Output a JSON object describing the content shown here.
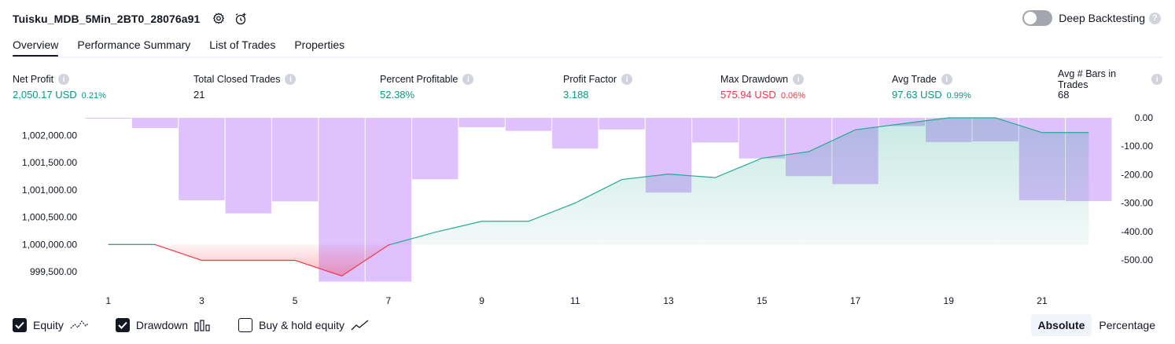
{
  "header": {
    "title": "Tuisku_MDB_5Min_2BT0_28076a91",
    "deep_backtesting_label": "Deep Backtesting",
    "help_glyph": "?"
  },
  "tabs": [
    {
      "label": "Overview",
      "active": true
    },
    {
      "label": "Performance Summary",
      "active": false
    },
    {
      "label": "List of Trades",
      "active": false
    },
    {
      "label": "Properties",
      "active": false
    }
  ],
  "metrics": [
    {
      "label": "Net Profit",
      "value": "2,050.17 USD",
      "pct": "0.21%",
      "color": "green"
    },
    {
      "label": "Total Closed Trades",
      "value": "21",
      "pct": "",
      "color": "dark"
    },
    {
      "label": "Percent Profitable",
      "value": "52.38%",
      "pct": "",
      "color": "green"
    },
    {
      "label": "Profit Factor",
      "value": "3.188",
      "pct": "",
      "color": "green"
    },
    {
      "label": "Max Drawdown",
      "value": "575.94 USD",
      "pct": "0.06%",
      "color": "red"
    },
    {
      "label": "Avg Trade",
      "value": "97.63 USD",
      "pct": "0.99%",
      "color": "green"
    },
    {
      "label": "Avg # Bars in Trades",
      "value": "68",
      "pct": "",
      "color": "dark"
    }
  ],
  "legend": {
    "equity_label": "Equity",
    "drawdown_label": "Drawdown",
    "buyhold_label": "Buy & hold equity",
    "equity_checked": true,
    "drawdown_checked": true,
    "buyhold_checked": false
  },
  "mode": {
    "absolute_label": "Absolute",
    "percentage_label": "Percentage",
    "selected": "Absolute"
  },
  "colors": {
    "equity_line": "#22ab94",
    "equity_fill": "#089981",
    "loss_line": "#f23645",
    "drawdown_bar": "#c084fc",
    "text": "#131722",
    "muted": "#787b86"
  },
  "chart_data": {
    "type": "bar+line",
    "x_ticks": [
      "1",
      "3",
      "5",
      "7",
      "9",
      "11",
      "13",
      "15",
      "17",
      "19",
      "21"
    ],
    "left_axis": {
      "ticks": [
        "1,002,000.00",
        "1,001,500.00",
        "1,001,000.00",
        "1,000,500.00",
        "1,000,000.00",
        "999,500.00"
      ],
      "ylim": [
        999300,
        1002320
      ]
    },
    "right_axis": {
      "ticks": [
        "0.00",
        "-100.00",
        "-200.00",
        "-300.00",
        "-400.00",
        "-500.00"
      ],
      "ylim": [
        -580,
        0
      ]
    },
    "series": [
      {
        "name": "Equity",
        "axis": "left",
        "x": [
          1,
          2,
          3,
          4,
          5,
          6,
          7,
          8,
          9,
          10,
          11,
          12,
          13,
          14,
          15,
          16,
          17,
          18,
          19,
          20,
          21,
          22
        ],
        "values": [
          1000000,
          1000000,
          999710,
          999710,
          999710,
          999424,
          999990,
          1000225,
          1000425,
          1000425,
          1000760,
          1001190,
          1001290,
          1001225,
          1001580,
          1001700,
          1002100,
          1002210,
          1002320,
          1002320,
          1002050,
          1002050
        ]
      },
      {
        "name": "Drawdown",
        "axis": "right",
        "x": [
          1,
          2,
          3,
          4,
          5,
          6,
          7,
          8,
          9,
          10,
          11,
          12,
          13,
          14,
          15,
          16,
          17,
          18,
          19,
          20,
          21,
          22
        ],
        "values": [
          -1,
          -36,
          -290,
          -336,
          -294,
          -576,
          -576,
          -216,
          -33,
          -46,
          -108,
          -41,
          -263,
          -87,
          -143,
          -205,
          -233,
          -29,
          -85,
          -83,
          -290,
          -293
        ]
      }
    ]
  }
}
